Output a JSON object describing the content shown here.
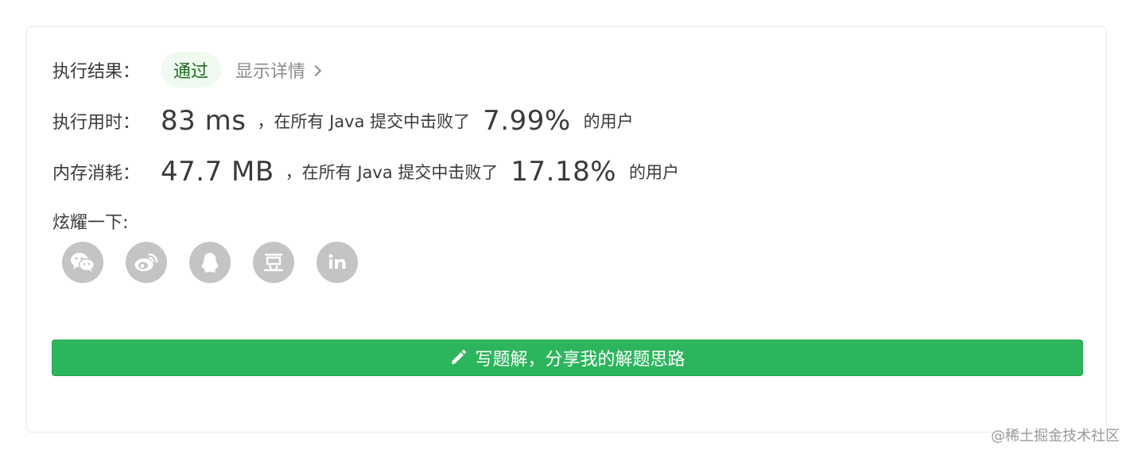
{
  "result": {
    "label": "执行结果：",
    "status": "通过",
    "detail_link": "显示详情"
  },
  "runtime": {
    "label": "执行用时：",
    "value": "83 ms",
    "middle": "，在所有 Java 提交中击败了",
    "percent": "7.99%",
    "suffix": "的用户"
  },
  "memory": {
    "label": "内存消耗：",
    "value": "47.7 MB",
    "middle": "，在所有 Java 提交中击败了",
    "percent": "17.18%",
    "suffix": "的用户"
  },
  "share": {
    "label": "炫耀一下:",
    "icons": [
      "wechat-icon",
      "weibo-icon",
      "qq-icon",
      "douban-icon",
      "linkedin-icon"
    ]
  },
  "write_button": {
    "label": "写题解，分享我的解题思路"
  },
  "watermark": "@稀土掘金技术社区",
  "colors": {
    "accent_green": "#2db55d",
    "status_bg": "#f0faf0",
    "icon_gray": "#c4c4c4"
  }
}
